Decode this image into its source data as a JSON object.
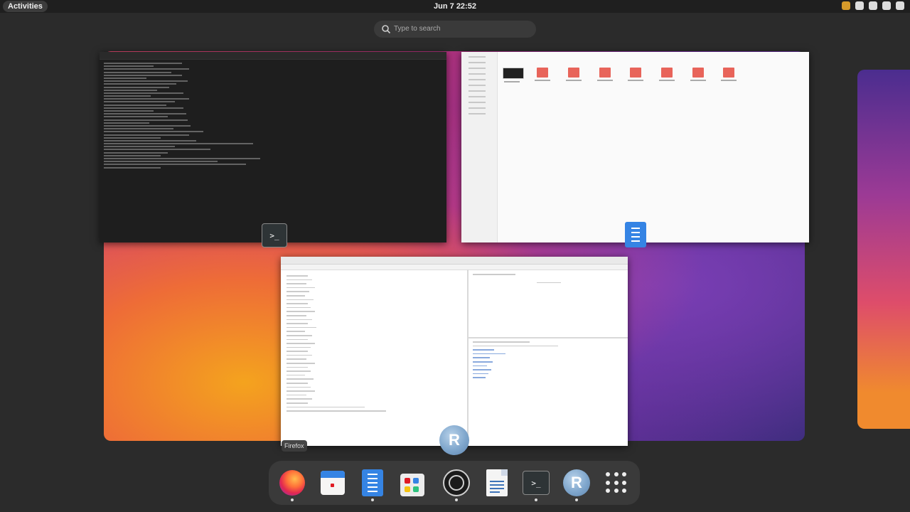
{
  "topbar": {
    "activities": "Activities",
    "clock": "Jun 7  22:52",
    "tray_icons": [
      "notification-icon",
      "network-icon",
      "volume-icon",
      "microphone-icon",
      "power-icon"
    ]
  },
  "search": {
    "placeholder": "Type to search"
  },
  "windows": {
    "terminal": {
      "icon": "terminal-icon"
    },
    "files": {
      "icon": "document-icon"
    },
    "rstudio": {
      "icon": "r-logo-icon"
    }
  },
  "tooltip": {
    "label": "Firefox"
  },
  "dash": {
    "apps": [
      {
        "name": "firefox",
        "icon": "firefox-icon",
        "running": true
      },
      {
        "name": "calendar",
        "icon": "calendar-icon",
        "running": false
      },
      {
        "name": "text-editor",
        "icon": "document-icon",
        "running": true
      },
      {
        "name": "software",
        "icon": "software-bag-icon",
        "running": false
      },
      {
        "name": "obs",
        "icon": "obs-icon",
        "running": true
      },
      {
        "name": "writer",
        "icon": "writer-icon",
        "running": false
      },
      {
        "name": "terminal",
        "icon": "terminal-icon",
        "running": true
      },
      {
        "name": "rstudio",
        "icon": "r-logo-icon",
        "running": true
      },
      {
        "name": "show-apps",
        "icon": "app-grid-icon",
        "running": false
      }
    ]
  },
  "colors": {
    "accent": "#3584e4",
    "topbar": "#1f1f1f",
    "dash": "#3a3a3a"
  }
}
